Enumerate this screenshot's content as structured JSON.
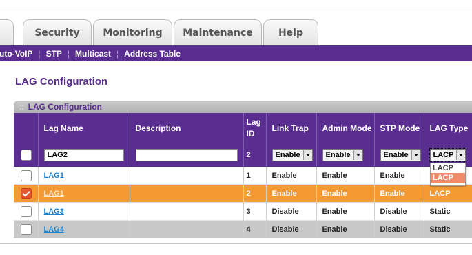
{
  "tabs": [
    "Security",
    "Monitoring",
    "Maintenance",
    "Help"
  ],
  "subnav": [
    "uto-VoIP",
    "STP",
    "Multicast",
    "Address Table"
  ],
  "page_title": "LAG Configuration",
  "panel_title": "LAG Configuration",
  "panel_grip": "::",
  "columns": {
    "lag_name": "Lag Name",
    "description": "Description",
    "lag_id_1": "Lag",
    "lag_id_2": "ID",
    "link_trap": "Link Trap",
    "admin_mode": "Admin Mode",
    "stp_mode": "STP Mode",
    "lag_type": "LAG Type"
  },
  "edit_row": {
    "lag_name": "LAG2",
    "description": "",
    "lag_id": "2",
    "link_trap": "Enable",
    "admin_mode": "Enable",
    "stp_mode": "Enable",
    "lag_type": "LACP"
  },
  "lag_type_dropdown": [
    "LACP",
    "LACP"
  ],
  "rows": [
    {
      "lag_name": "LAG1",
      "description": "",
      "lag_id": "1",
      "link_trap": "Enable",
      "admin_mode": "Enable",
      "stp_mode": "Enable",
      "lag_type": "LACP"
    },
    {
      "lag_name": "LAG1",
      "description": "",
      "lag_id": "2",
      "link_trap": "Enable",
      "admin_mode": "Enable",
      "stp_mode": "Enable",
      "lag_type": "LACP"
    },
    {
      "lag_name": "LAG3",
      "description": "",
      "lag_id": "3",
      "link_trap": "Disable",
      "admin_mode": "Enable",
      "stp_mode": "Disable",
      "lag_type": "Static"
    },
    {
      "lag_name": "LAG4",
      "description": "",
      "lag_id": "4",
      "link_trap": "Disable",
      "admin_mode": "Enable",
      "stp_mode": "Disable",
      "lag_type": "Static"
    }
  ],
  "colors": {
    "brand_purple": "#5a2d91",
    "selected_row": "#f39a34",
    "link_blue": "#1b7ec7",
    "grey_row": "#c8c8c8"
  }
}
